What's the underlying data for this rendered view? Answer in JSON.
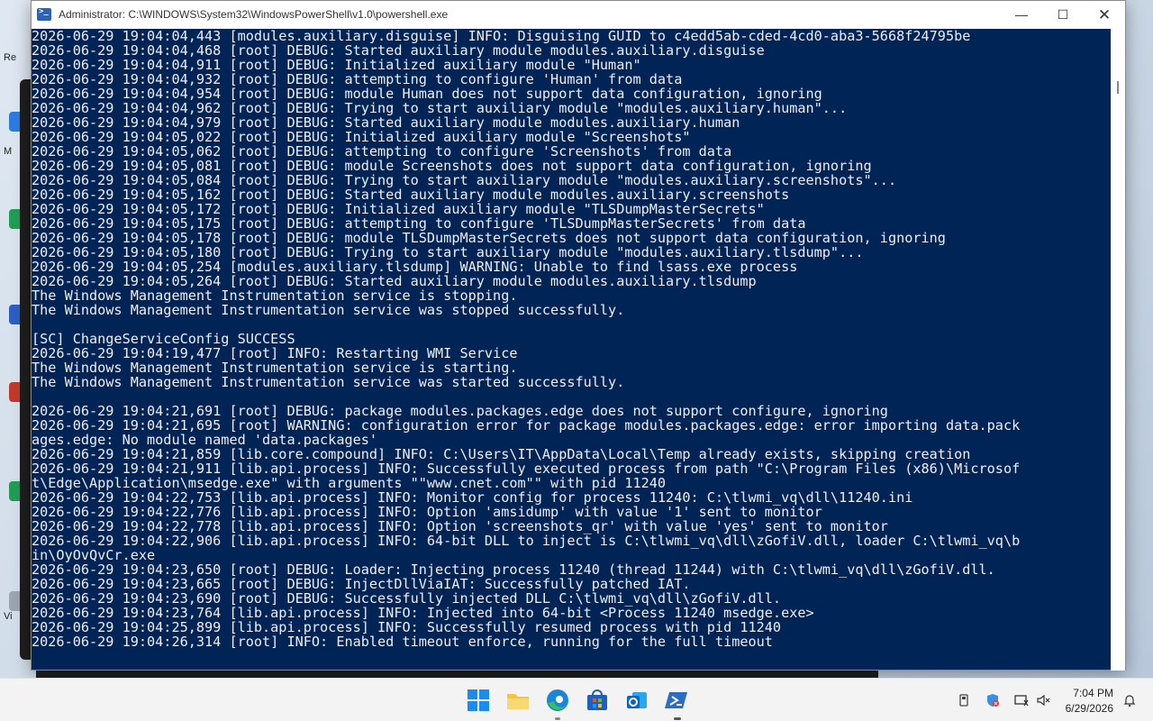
{
  "window": {
    "title": "Administrator: C:\\WINDOWS\\System32\\WindowsPowerShell\\v1.0\\powershell.exe",
    "minimize": "—",
    "maximize": "☐",
    "close": "✕"
  },
  "console": {
    "lines": [
      "2026-06-29 19:04:04,443 [modules.auxiliary.disguise] INFO: Disguising GUID to c4edd5ab-cded-4cd0-aba3-5668f24795be",
      "2026-06-29 19:04:04,468 [root] DEBUG: Started auxiliary module modules.auxiliary.disguise",
      "2026-06-29 19:04:04,911 [root] DEBUG: Initialized auxiliary module \"Human\"",
      "2026-06-29 19:04:04,932 [root] DEBUG: attempting to configure 'Human' from data",
      "2026-06-29 19:04:04,954 [root] DEBUG: module Human does not support data configuration, ignoring",
      "2026-06-29 19:04:04,962 [root] DEBUG: Trying to start auxiliary module \"modules.auxiliary.human\"...",
      "2026-06-29 19:04:04,979 [root] DEBUG: Started auxiliary module modules.auxiliary.human",
      "2026-06-29 19:04:05,022 [root] DEBUG: Initialized auxiliary module \"Screenshots\"",
      "2026-06-29 19:04:05,062 [root] DEBUG: attempting to configure 'Screenshots' from data",
      "2026-06-29 19:04:05,081 [root] DEBUG: module Screenshots does not support data configuration, ignoring",
      "2026-06-29 19:04:05,084 [root] DEBUG: Trying to start auxiliary module \"modules.auxiliary.screenshots\"...",
      "2026-06-29 19:04:05,162 [root] DEBUG: Started auxiliary module modules.auxiliary.screenshots",
      "2026-06-29 19:04:05,172 [root] DEBUG: Initialized auxiliary module \"TLSDumpMasterSecrets\"",
      "2026-06-29 19:04:05,175 [root] DEBUG: attempting to configure 'TLSDumpMasterSecrets' from data",
      "2026-06-29 19:04:05,178 [root] DEBUG: module TLSDumpMasterSecrets does not support data configuration, ignoring",
      "2026-06-29 19:04:05,180 [root] DEBUG: Trying to start auxiliary module \"modules.auxiliary.tlsdump\"...",
      "2026-06-29 19:04:05,254 [modules.auxiliary.tlsdump] WARNING: Unable to find lsass.exe process",
      "2026-06-29 19:04:05,264 [root] DEBUG: Started auxiliary module modules.auxiliary.tlsdump",
      "The Windows Management Instrumentation service is stopping.",
      "The Windows Management Instrumentation service was stopped successfully.",
      "",
      "[SC] ChangeServiceConfig SUCCESS",
      "2026-06-29 19:04:19,477 [root] INFO: Restarting WMI Service",
      "The Windows Management Instrumentation service is starting.",
      "The Windows Management Instrumentation service was started successfully.",
      "",
      "2026-06-29 19:04:21,691 [root] DEBUG: package modules.packages.edge does not support configure, ignoring",
      "2026-06-29 19:04:21,695 [root] WARNING: configuration error for package modules.packages.edge: error importing data.pack",
      "ages.edge: No module named 'data.packages'",
      "2026-06-29 19:04:21,859 [lib.core.compound] INFO: C:\\Users\\IT\\AppData\\Local\\Temp already exists, skipping creation",
      "2026-06-29 19:04:21,911 [lib.api.process] INFO: Successfully executed process from path \"C:\\Program Files (x86)\\Microsof",
      "t\\Edge\\Application\\msedge.exe\" with arguments \"\"www.cnet.com\"\" with pid 11240",
      "2026-06-29 19:04:22,753 [lib.api.process] INFO: Monitor config for process 11240: C:\\tlwmi_vq\\dll\\11240.ini",
      "2026-06-29 19:04:22,776 [lib.api.process] INFO: Option 'amsidump' with value '1' sent to monitor",
      "2026-06-29 19:04:22,778 [lib.api.process] INFO: Option 'screenshots_qr' with value 'yes' sent to monitor",
      "2026-06-29 19:04:22,906 [lib.api.process] INFO: 64-bit DLL to inject is C:\\tlwmi_vq\\dll\\zGofiV.dll, loader C:\\tlwmi_vq\\b",
      "in\\OyOvQvCr.exe",
      "2026-06-29 19:04:23,650 [root] DEBUG: Loader: Injecting process 11240 (thread 11244) with C:\\tlwmi_vq\\dll\\zGofiV.dll.",
      "2026-06-29 19:04:23,665 [root] DEBUG: InjectDllViaIAT: Successfully patched IAT.",
      "2026-06-29 19:04:23,690 [root] DEBUG: Successfully injected DLL C:\\tlwmi_vq\\dll\\zGofiV.dll.",
      "2026-06-29 19:04:23,764 [lib.api.process] INFO: Injected into 64-bit <Process 11240 msedge.exe>",
      "2026-06-29 19:04:25,899 [lib.api.process] INFO: Successfully resumed process with pid 11240",
      "2026-06-29 19:04:26,314 [root] INFO: Enabled timeout enforce, running for the full timeout"
    ]
  },
  "desktop": {
    "labels": [
      "Re",
      "M",
      "Vi"
    ]
  },
  "taskbar": {
    "apps": [
      {
        "name": "start",
        "icon": "windows-start-icon"
      },
      {
        "name": "file-explorer",
        "icon": "folder-icon"
      },
      {
        "name": "edge",
        "icon": "edge-icon"
      },
      {
        "name": "store",
        "icon": "store-icon"
      },
      {
        "name": "outlook",
        "icon": "outlook-icon"
      },
      {
        "name": "powershell",
        "icon": "powershell-icon"
      }
    ],
    "time": "7:04 PM",
    "date": "6/29/2026"
  },
  "colors": {
    "console_bg": "#012456",
    "console_fg": "#eeedf0",
    "taskbar_bg": "#f3f3f3"
  }
}
